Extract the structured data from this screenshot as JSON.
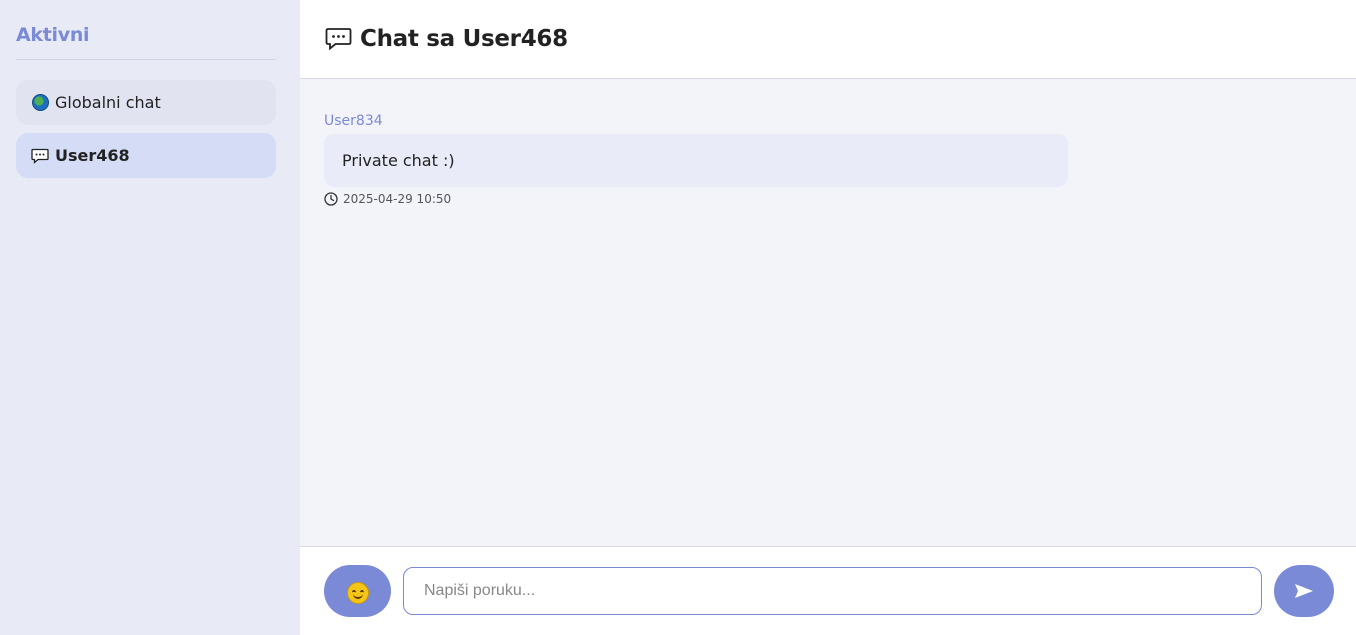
{
  "sidebar": {
    "title": "Aktivni",
    "items": [
      {
        "label": "Globalni chat",
        "icon": "globe-icon",
        "active": false
      },
      {
        "label": "User468",
        "icon": "speech-bubble-icon",
        "active": true
      }
    ]
  },
  "header": {
    "icon": "speech-bubble-icon",
    "title": "Chat sa User468"
  },
  "messages": [
    {
      "sender": "User834",
      "text": "Private chat :)",
      "timestamp": "2025-04-29 10:50"
    }
  ],
  "composer": {
    "emoji_icon": "smiley-icon",
    "placeholder": "Napiši poruku...",
    "value": "",
    "send_icon": "send-arrow-icon"
  },
  "colors": {
    "accent": "#7b8ad6",
    "sidebar_bg": "#e8ebf6",
    "active_item_bg": "#d5dcf5",
    "messages_bg": "#f3f4f9",
    "bubble_bg": "#e9ebf8"
  }
}
